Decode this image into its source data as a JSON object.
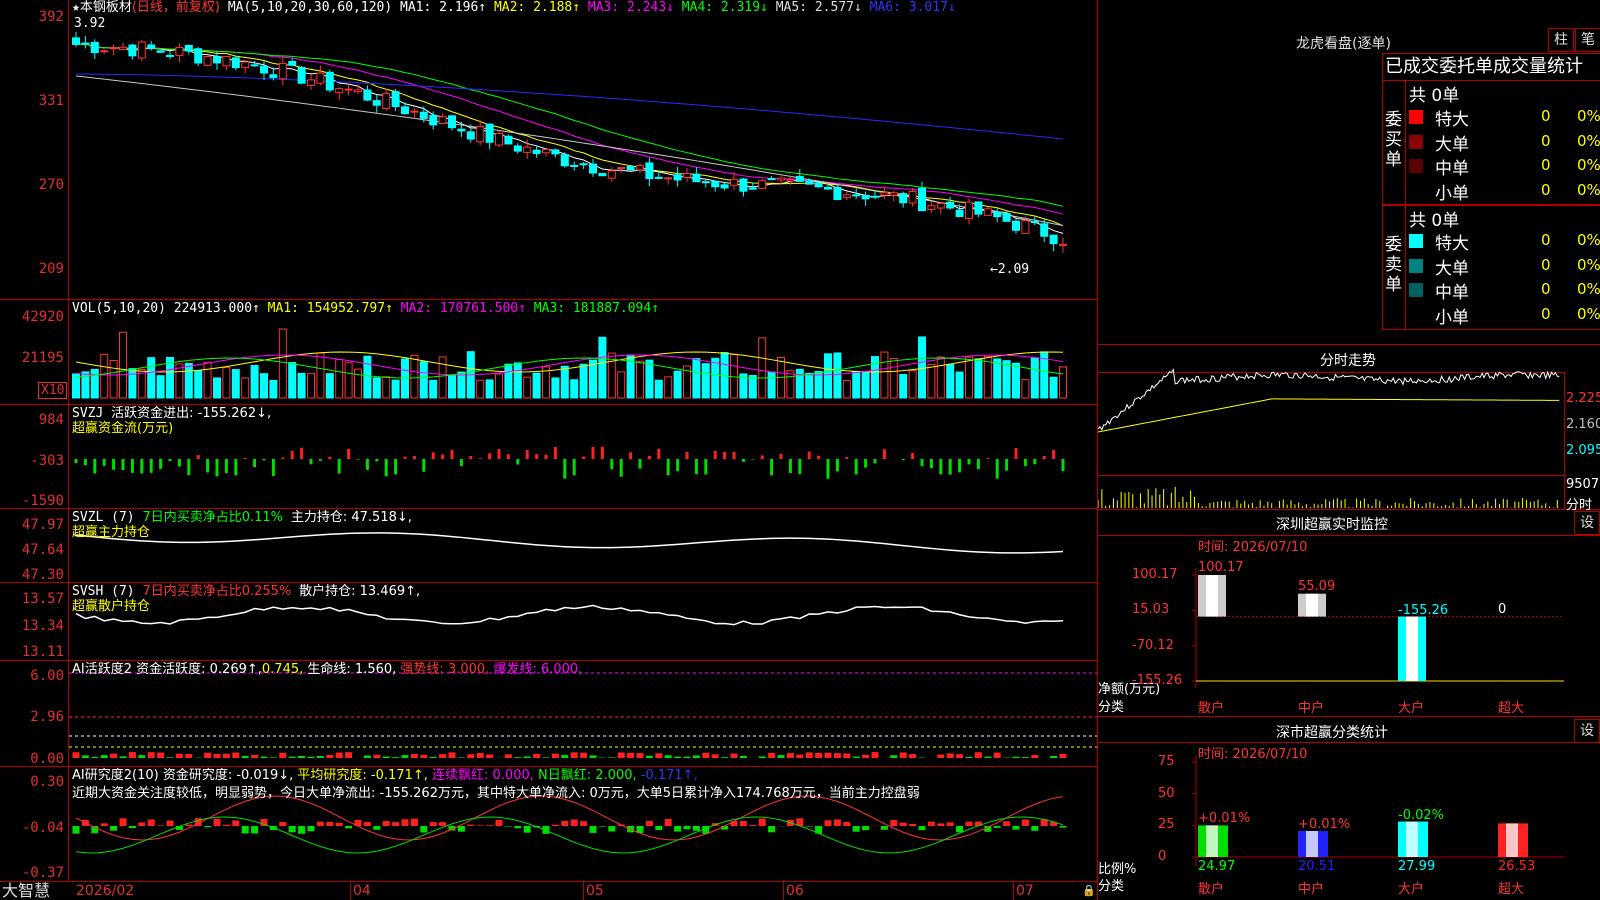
{
  "colors": {
    "up": "#ff3333",
    "down": "#00ffff",
    "grid": "#b00000"
  },
  "price": {
    "y_ticks": [
      "392",
      "331",
      "270",
      "209"
    ],
    "high_marker": "3.92",
    "low_marker": "←2.09",
    "legend": {
      "star": "★",
      "name": "本钢板材",
      "cycle": "(日线，前复权)",
      "ma": "MA(5,10,20,30,60,120)",
      "ma1": "MA1: 2.196↑",
      "ma2": "MA2: 2.188↑",
      "ma3": "MA3: 2.243↓",
      "ma4": "MA4: 2.319↓",
      "ma5": "MA5: 2.577↓",
      "ma6": "MA6: 3.017↓"
    }
  },
  "vol": {
    "y_ticks": [
      "42920",
      "21195"
    ],
    "multiplier": "X10",
    "legend": {
      "label": "VOL(5,10,20)",
      "value": "224913.000↑",
      "ma1": "MA1: 154952.797↑",
      "ma2": "MA2: 170761.500↑",
      "ma3": "MA3: 181887.094↑"
    }
  },
  "svzj": {
    "y_ticks": [
      "984",
      "-303",
      "-1590"
    ],
    "legend": {
      "label": "SVZJ",
      "text": "活跃资金进出: -155.262↓,",
      "sub": "超赢资金流(万元)"
    }
  },
  "svzl": {
    "y_ticks": [
      "47.97",
      "47.64",
      "47.30"
    ],
    "legend": {
      "label": "SVZL (7)",
      "ratio": "7日内买卖净占比0.11%",
      "hold": "主力持仓: 47.518↓,",
      "sub": "超赢主力持仓"
    }
  },
  "svsh": {
    "y_ticks": [
      "13.57",
      "13.34",
      "13.11"
    ],
    "legend": {
      "label": "SVSH (7)",
      "ratio": "7日内买卖净占比0.255%",
      "hold": "散户持仓: 13.469↑,",
      "sub": "超赢散户持仓"
    }
  },
  "ai_active": {
    "y_ticks": [
      "6.00",
      "2.96",
      "0.00"
    ],
    "legend": {
      "label": "AI活跃度2",
      "v1": "资金活跃度: 0.269↑,",
      "v2": "0.745,",
      "v3": "生命线: 1.560,",
      "v4": "强势线: 3.000,",
      "v5": "爆发线: 6.000,"
    }
  },
  "ai_research": {
    "y_ticks": [
      "0.30",
      "-0.04",
      "-0.37"
    ],
    "legend": {
      "label": "AI研究度2(10)",
      "v1": "资金研究度: -0.019↓,",
      "v2": "平均研究度: -0.171↑,",
      "v3": "连续飘红: 0.000,",
      "v4": "N日飘红: 2.000,",
      "v5": "-0.171↑,"
    },
    "comment": "近期大资金关注度较低，明显弱势，今日大单净流出: -155.262万元，其中特大单净流入: 0万元，大单5日累计净入174.768万元，当前主力控盘弱"
  },
  "x_axis": {
    "brand": "大智慧",
    "labels": [
      "2026/02",
      "04",
      "05",
      "06",
      "07"
    ]
  },
  "dragon": {
    "title": "龙虎看盘(逐单)",
    "btn_col": "柱",
    "btn_pen": "笔",
    "tab_title": "已成交委托单成交量统计",
    "buy": {
      "label": "委买单",
      "total": "共 0单",
      "rows": [
        {
          "name": "特大",
          "color": "#ff0000",
          "value": "0",
          "pct": "0%"
        },
        {
          "name": "大单",
          "color": "#8b0000",
          "value": "0",
          "pct": "0%"
        },
        {
          "name": "中单",
          "color": "#5a0000",
          "value": "0",
          "pct": "0%"
        },
        {
          "name": "小单",
          "color": "#000000",
          "value": "0",
          "pct": "0%"
        }
      ]
    },
    "sell": {
      "label": "委卖单",
      "total": "共 0单",
      "rows": [
        {
          "name": "特大",
          "color": "#00ffff",
          "value": "0",
          "pct": "0%"
        },
        {
          "name": "大单",
          "color": "#008080",
          "value": "0",
          "pct": "0%"
        },
        {
          "name": "中单",
          "color": "#006060",
          "value": "0",
          "pct": "0%"
        },
        {
          "name": "小单",
          "color": "#000000",
          "value": "0",
          "pct": "0%"
        }
      ]
    }
  },
  "intraday": {
    "title": "分时走势",
    "y_ticks": [
      "2.225",
      "2.160",
      "2.095"
    ],
    "vol_tick": "9507",
    "vol_label": "分时"
  },
  "monitor": {
    "title": "深圳超赢实时监控",
    "btn": "设",
    "time": "时间: 2026/07/10",
    "y_ticks": [
      "100.17",
      "15.03",
      "-70.12",
      "-155.26"
    ],
    "unit": "净额(万元)",
    "cat_title": "分类",
    "bars": [
      {
        "name": "散户",
        "value": 100.17,
        "label": "100.17"
      },
      {
        "name": "中户",
        "value": 55.09,
        "label": "55.09"
      },
      {
        "name": "大户",
        "value": -155.26,
        "label": "-155.26"
      },
      {
        "name": "超大",
        "value": 0,
        "label": "0"
      }
    ]
  },
  "classify": {
    "title": "深市超赢分类统计",
    "btn": "设",
    "time": "时间: 2026/07/10",
    "y_ticks": [
      "75",
      "50",
      "25",
      "0"
    ],
    "unit": "比例%",
    "cat_title": "分类",
    "bars": [
      {
        "name": "散户",
        "value": 24.97,
        "change": "+0.01%",
        "color": "#00dd00"
      },
      {
        "name": "中户",
        "value": 20.51,
        "change": "+0.01%",
        "color": "#2222ff"
      },
      {
        "name": "大户",
        "value": 27.99,
        "change": "-0.02%",
        "color": "#00ffff"
      },
      {
        "name": "超大",
        "value": 26.53,
        "change": "",
        "color": "#ff2222"
      }
    ]
  }
}
